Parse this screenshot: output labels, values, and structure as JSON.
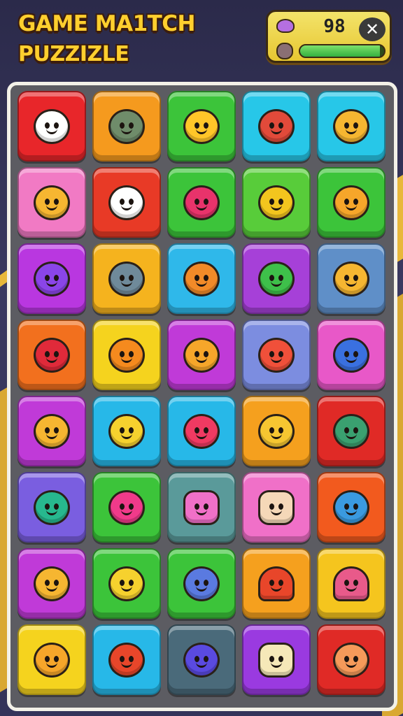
{
  "title": {
    "line1": "GAME MA1TCH",
    "line2": "PUZZIZLE"
  },
  "hud": {
    "score": "98",
    "close_glyph": "✕",
    "progress": 0.95,
    "icons": [
      "creature-icon",
      "creature-icon"
    ]
  },
  "board": {
    "rows": [
      [
        {
          "bg": "#e8262a",
          "face": "#ffffff",
          "shape": "round",
          "icon": "ghost-face-icon"
        },
        {
          "bg": "#f59a1e",
          "face": "#6f8c6a",
          "shape": "round",
          "icon": "zombie-face-icon"
        },
        {
          "bg": "#3cc43a",
          "face": "#ffc629",
          "shape": "round",
          "icon": "sun-face-icon"
        },
        {
          "bg": "#27c7e8",
          "face": "#e24a3a",
          "shape": "round",
          "icon": "spiky-ball-icon"
        },
        {
          "bg": "#27c7e8",
          "face": "#f6b631",
          "shape": "round",
          "icon": "bear-face-icon"
        }
      ],
      [
        {
          "bg": "#f17ac4",
          "face": "#f6b631",
          "shape": "round",
          "icon": "cat-face-icon"
        },
        {
          "bg": "#e83a26",
          "face": "#ffffff",
          "shape": "round",
          "icon": "ghost-cat-icon"
        },
        {
          "bg": "#3cc43a",
          "face": "#e8336b",
          "shape": "round",
          "icon": "monster-face-icon"
        },
        {
          "bg": "#58cc3a",
          "face": "#f3c51e",
          "shape": "round",
          "icon": "snail-icon"
        },
        {
          "bg": "#3cc43a",
          "face": "#f6a62a",
          "shape": "round",
          "icon": "sun-icon"
        }
      ],
      [
        {
          "bg": "#b937e0",
          "face": "#8a45e8",
          "shape": "round",
          "icon": "cat-face-icon"
        },
        {
          "bg": "#f5b31e",
          "face": "#6f8a9a",
          "shape": "round",
          "icon": "fish-icon"
        },
        {
          "bg": "#2fb8ea",
          "face": "#f28a28",
          "shape": "round",
          "icon": "sun-face-icon"
        },
        {
          "bg": "#a640d8",
          "face": "#3ec04a",
          "shape": "round",
          "icon": "lollipop-icon"
        },
        {
          "bg": "#5f8fc8",
          "face": "#f6b631",
          "shape": "round",
          "icon": "boy-face-icon"
        }
      ],
      [
        {
          "bg": "#f2701e",
          "face": "#e02a3a",
          "shape": "round",
          "icon": "gear-orb-icon"
        },
        {
          "bg": "#f5d31e",
          "face": "#f58a1e",
          "shape": "round",
          "icon": "sun-face-icon"
        },
        {
          "bg": "#c03ad8",
          "face": "#f6a62a",
          "shape": "round",
          "icon": "sun-ring-icon"
        },
        {
          "bg": "#7c8de0",
          "face": "#f0503a",
          "shape": "round",
          "icon": "virus-icon"
        },
        {
          "bg": "#e858c8",
          "face": "#3a70e0",
          "shape": "round",
          "icon": "swirl-icon"
        }
      ],
      [
        {
          "bg": "#c03ad8",
          "face": "#f6b631",
          "shape": "round",
          "icon": "chick-face-icon"
        },
        {
          "bg": "#27b8e8",
          "face": "#f6d12e",
          "shape": "round",
          "icon": "chick-face-icon"
        },
        {
          "bg": "#27b8e8",
          "face": "#f03a62",
          "shape": "round",
          "icon": "balloon-icon"
        },
        {
          "bg": "#f5a01e",
          "face": "#f6c631",
          "shape": "round",
          "icon": "girl-face-icon"
        },
        {
          "bg": "#e02a26",
          "face": "#3aa070",
          "shape": "round",
          "icon": "star-ring-icon"
        }
      ],
      [
        {
          "bg": "#7a5ee0",
          "face": "#27b88e",
          "shape": "round",
          "icon": "frog-face-icon"
        },
        {
          "bg": "#3cc43a",
          "face": "#f03a8a",
          "shape": "round",
          "icon": "blob-face-icon"
        },
        {
          "bg": "#5a9a9a",
          "face": "#f070c8",
          "shape": "sq",
          "icon": "box-face-icon"
        },
        {
          "bg": "#f070c8",
          "face": "#f5d8b8",
          "shape": "sq",
          "icon": "gift-box-icon"
        },
        {
          "bg": "#f25a1e",
          "face": "#3a9ae0",
          "shape": "round",
          "icon": "spiky-face-icon"
        }
      ],
      [
        {
          "bg": "#c03ad8",
          "face": "#f6b631",
          "shape": "round",
          "icon": "chick-face-icon"
        },
        {
          "bg": "#3cc43a",
          "face": "#f6d12e",
          "shape": "round",
          "icon": "bush-face-icon"
        },
        {
          "bg": "#3cc43a",
          "face": "#5a7ae0",
          "shape": "round",
          "icon": "bird-face-icon"
        },
        {
          "bg": "#f5a01e",
          "face": "#e8462a",
          "shape": "tri",
          "icon": "cone-icon"
        },
        {
          "bg": "#f5c51e",
          "face": "#e85a8a",
          "shape": "tri",
          "icon": "party-hat-icon"
        }
      ],
      [
        {
          "bg": "#f5d31e",
          "face": "#f6a62a",
          "shape": "round",
          "icon": "star-face-icon"
        },
        {
          "bg": "#27b8e8",
          "face": "#e8462a",
          "shape": "round",
          "icon": "fox-face-icon"
        },
        {
          "bg": "#4a6a7a",
          "face": "#5a4ae0",
          "shape": "round",
          "icon": "snake-icon"
        },
        {
          "bg": "#9a3ae0",
          "face": "#f5e8b8",
          "shape": "sq",
          "icon": "candle-box-icon"
        },
        {
          "bg": "#e02a26",
          "face": "#f59a5a",
          "shape": "round",
          "icon": "pig-face-icon"
        }
      ]
    ]
  }
}
